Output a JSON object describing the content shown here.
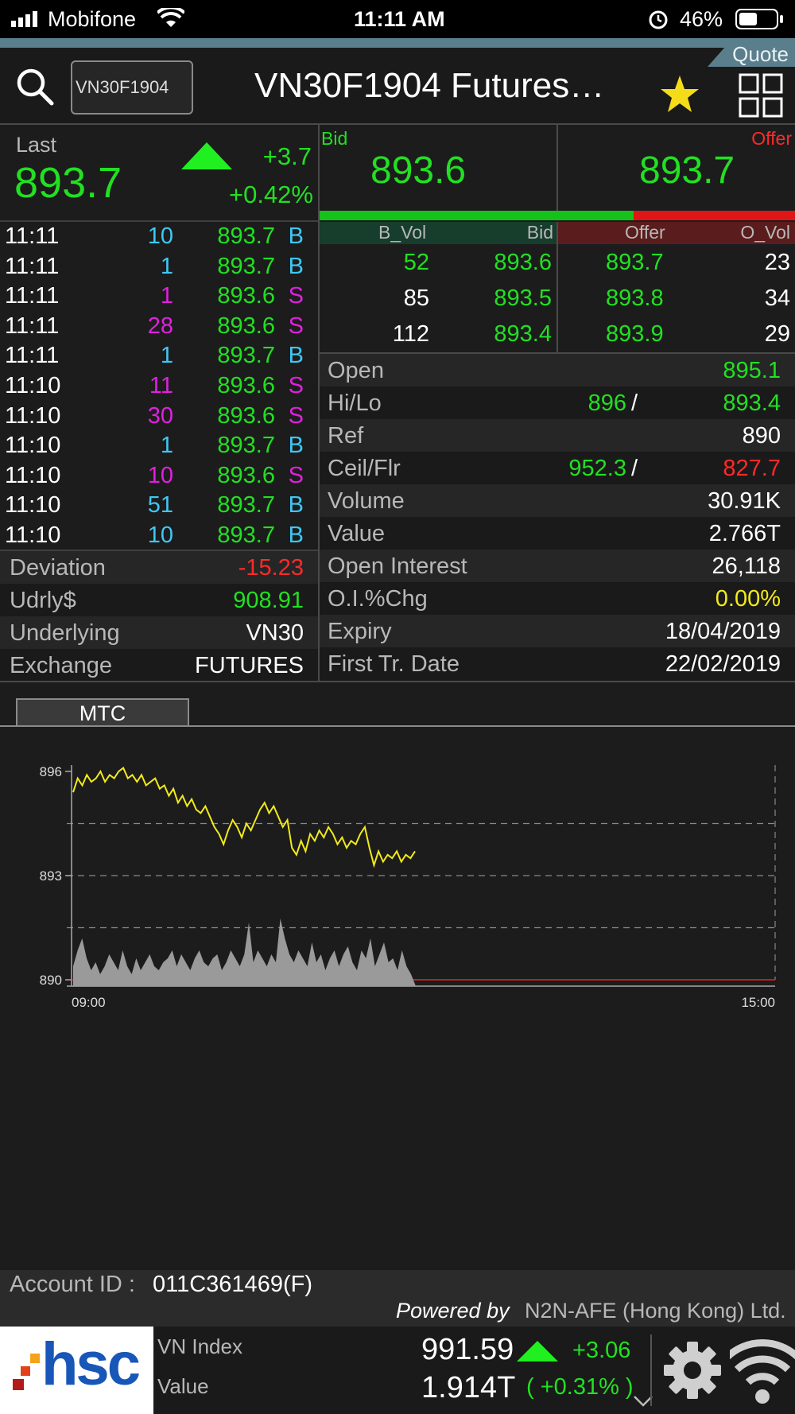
{
  "status_bar": {
    "carrier": "Mobifone",
    "time": "11:11 AM",
    "battery": "46%"
  },
  "header": {
    "tab": "Quote",
    "search_value": "VN30F1904",
    "title": "VN30F1904 Futures…"
  },
  "last": {
    "label": "Last",
    "price": "893.7",
    "change": "+3.7",
    "change_pct": "+0.42%"
  },
  "bid_offer": {
    "bid_label": "Bid",
    "bid": "893.6",
    "offer_label": "Offer",
    "offer": "893.7",
    "bid_ratio": 0.66
  },
  "depth": {
    "headers": [
      "B_Vol",
      "Bid",
      "Offer",
      "O_Vol"
    ],
    "rows": [
      {
        "bvol": "52",
        "bid": "893.6",
        "offer": "893.7",
        "ovol": "23"
      },
      {
        "bvol": "85",
        "bid": "893.5",
        "offer": "893.8",
        "ovol": "34"
      },
      {
        "bvol": "112",
        "bid": "893.4",
        "offer": "893.9",
        "ovol": "29"
      }
    ]
  },
  "ticks": [
    {
      "time": "11:11",
      "vol": "10",
      "price": "893.7",
      "side": "B"
    },
    {
      "time": "11:11",
      "vol": "1",
      "price": "893.7",
      "side": "B"
    },
    {
      "time": "11:11",
      "vol": "1",
      "price": "893.6",
      "side": "S"
    },
    {
      "time": "11:11",
      "vol": "28",
      "price": "893.6",
      "side": "S"
    },
    {
      "time": "11:11",
      "vol": "1",
      "price": "893.7",
      "side": "B"
    },
    {
      "time": "11:10",
      "vol": "11",
      "price": "893.6",
      "side": "S"
    },
    {
      "time": "11:10",
      "vol": "30",
      "price": "893.6",
      "side": "S"
    },
    {
      "time": "11:10",
      "vol": "1",
      "price": "893.7",
      "side": "B"
    },
    {
      "time": "11:10",
      "vol": "10",
      "price": "893.6",
      "side": "S"
    },
    {
      "time": "11:10",
      "vol": "51",
      "price": "893.7",
      "side": "B"
    },
    {
      "time": "11:10",
      "vol": "10",
      "price": "893.7",
      "side": "B"
    }
  ],
  "stats": {
    "open_label": "Open",
    "open": "895.1",
    "hilo_label": "Hi/Lo",
    "hi": "896",
    "lo": "893.4",
    "ref_label": "Ref",
    "ref": "890",
    "ceil_label": "Ceil/Flr",
    "ceil": "952.3",
    "floor": "827.7",
    "volume_label": "Volume",
    "volume": "30.91K",
    "value_label": "Value",
    "value": "2.766T",
    "oi_label": "Open Interest",
    "oi": "26,118",
    "oichg_label": "O.I.%Chg",
    "oichg": "0.00%",
    "expiry_label": "Expiry",
    "expiry": "18/04/2019",
    "first_label": "First Tr. Date",
    "first": "22/02/2019",
    "separator": "/"
  },
  "left_stats": {
    "deviation_label": "Deviation",
    "deviation": "-15.23",
    "udrly_label": "Udrly$",
    "udrly": "908.91",
    "underlying_label": "Underlying",
    "underlying": "VN30",
    "exchange_label": "Exchange",
    "exchange": "FUTURES"
  },
  "chart_tab": "MTC",
  "chart_data": {
    "type": "line",
    "ylim": [
      890,
      896
    ],
    "y_ticks": [
      "896",
      "893",
      "890"
    ],
    "x_ticks": [
      "09:00",
      "15:00"
    ],
    "series": [
      {
        "values": [
          895.4,
          895.8,
          895.6,
          895.9,
          895.7,
          895.8,
          896.0,
          895.7,
          895.9,
          895.8,
          896.0,
          896.1,
          895.8,
          895.9,
          895.7,
          895.9,
          895.6,
          895.7,
          895.8,
          895.5,
          895.6,
          895.3,
          895.5,
          895.1,
          895.3,
          895.0,
          895.2,
          894.9,
          894.8,
          895.0,
          894.7,
          894.4,
          894.2,
          893.9,
          894.3,
          894.6,
          894.4,
          894.1,
          894.5,
          894.3,
          894.6,
          894.9,
          895.1,
          894.8,
          895.0,
          894.7,
          894.4,
          894.6,
          893.8,
          893.6,
          894.0,
          893.7,
          894.2,
          894.0,
          894.3,
          894.1,
          894.4,
          894.2,
          893.9,
          894.1,
          893.8,
          894.0,
          893.9,
          894.2,
          894.4,
          893.8,
          893.3,
          893.7,
          893.4,
          893.6,
          893.5,
          893.7,
          893.4,
          893.6,
          893.5,
          893.7
        ]
      }
    ],
    "volume": [
      5,
      9,
      12,
      7,
      4,
      6,
      3,
      5,
      8,
      6,
      4,
      9,
      5,
      3,
      7,
      4,
      6,
      8,
      5,
      4,
      6,
      7,
      9,
      5,
      8,
      6,
      4,
      7,
      9,
      6,
      5,
      7,
      8,
      4,
      6,
      9,
      7,
      5,
      8,
      16,
      6,
      9,
      7,
      5,
      8,
      6,
      17,
      12,
      8,
      6,
      9,
      7,
      5,
      11,
      6,
      8,
      4,
      7,
      9,
      5,
      8,
      10,
      6,
      4,
      9,
      7,
      12,
      5,
      8,
      11,
      6,
      7,
      4,
      9,
      5,
      3
    ]
  },
  "footer": {
    "account_label": "Account ID :",
    "account_id": "011C361469(F)",
    "powered_prefix": "Powered by",
    "powered_by": "N2N-AFE (Hong Kong) Ltd.",
    "logo": "hsc",
    "index_label": "VN Index",
    "index_value": "991.59",
    "index_change": "+3.06",
    "value_label": "Value",
    "value": "1.914T",
    "value_pct": "( +0.31% )"
  }
}
